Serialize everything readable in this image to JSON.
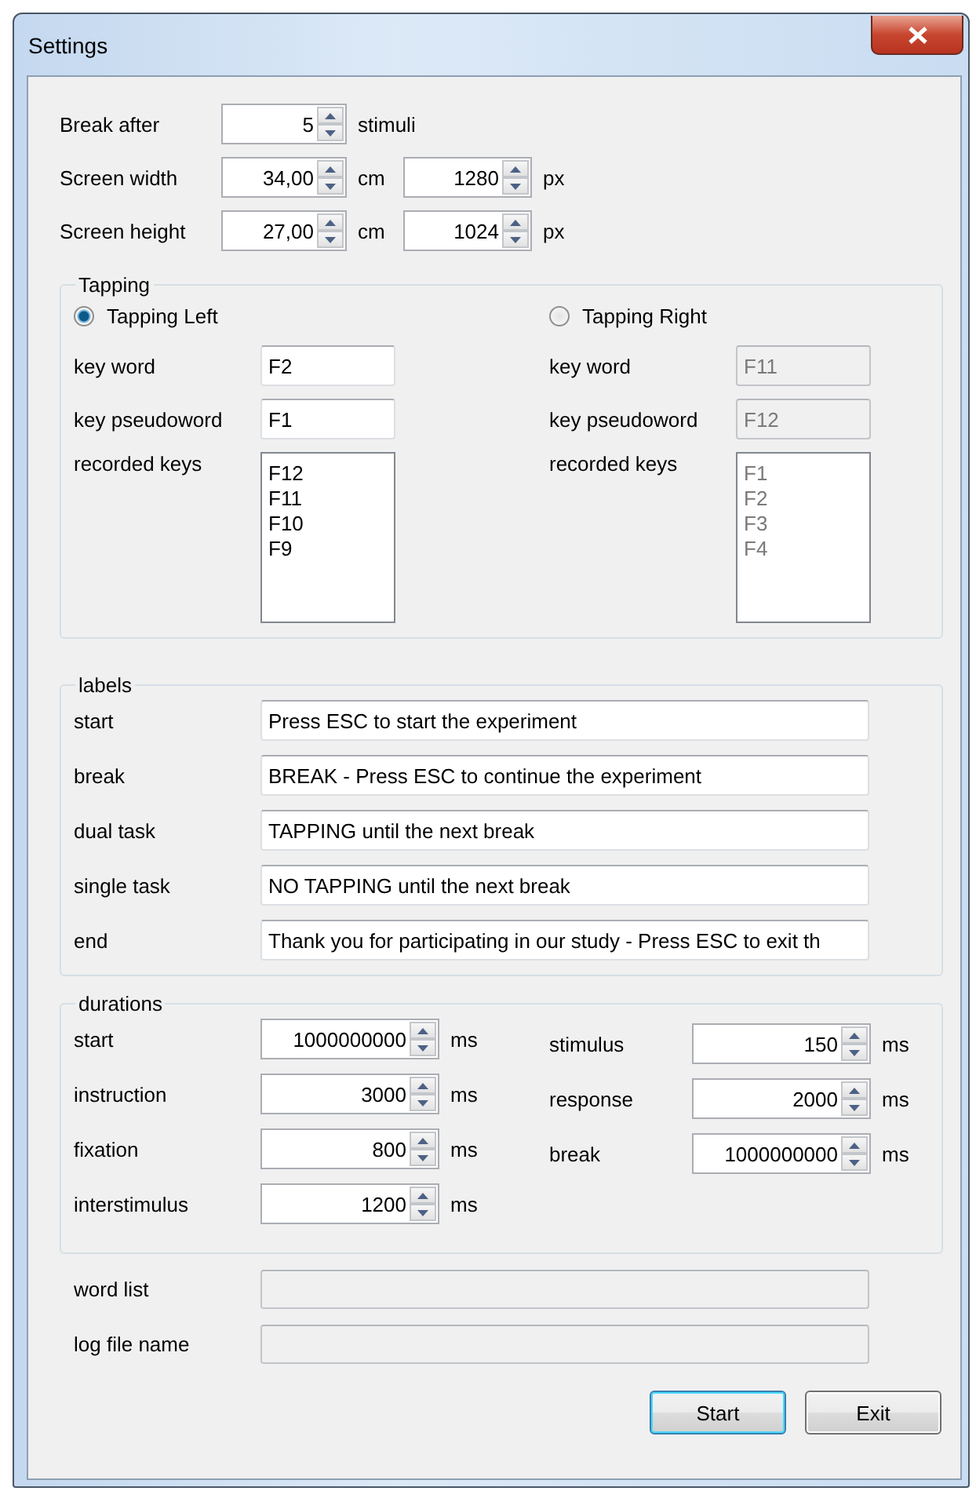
{
  "window": {
    "title": "Settings"
  },
  "screen": [
    {
      "label": "Break after",
      "inputs": [
        {
          "value": "5",
          "unit": "stimuli"
        }
      ]
    },
    {
      "label": "Screen width",
      "inputs": [
        {
          "value": "34,00",
          "unit": "cm"
        },
        {
          "value": "1280",
          "unit": "px"
        }
      ]
    },
    {
      "label": "Screen height",
      "inputs": [
        {
          "value": "27,00",
          "unit": "cm"
        },
        {
          "value": "1024",
          "unit": "px"
        }
      ]
    }
  ],
  "tapping": {
    "title": "Tapping",
    "sides": [
      {
        "label": "Tapping Left",
        "selected": true,
        "disabled": false,
        "fields": [
          {
            "label": "key word",
            "value": "F2"
          },
          {
            "label": "key pseudoword",
            "value": "F1"
          }
        ],
        "recorded_label": "recorded keys",
        "recorded_keys": [
          "F12",
          "F11",
          "F10",
          "F9"
        ]
      },
      {
        "label": "Tapping Right",
        "selected": false,
        "disabled": true,
        "fields": [
          {
            "label": "key word",
            "value": "F11"
          },
          {
            "label": "key pseudoword",
            "value": "F12"
          }
        ],
        "recorded_label": "recorded keys",
        "recorded_keys": [
          "F1",
          "F2",
          "F3",
          "F4"
        ]
      }
    ]
  },
  "labels": {
    "title": "labels",
    "rows": [
      {
        "label": "start",
        "value": "Press ESC to start the experiment"
      },
      {
        "label": "break",
        "value": "BREAK - Press ESC to continue the experiment"
      },
      {
        "label": "dual task",
        "value": "TAPPING until the next break"
      },
      {
        "label": "single task",
        "value": "NO TAPPING until the next break"
      },
      {
        "label": "end",
        "value": "Thank you for participating in our study - Press ESC to exit th"
      }
    ]
  },
  "durations": {
    "title": "durations",
    "columns": [
      [
        {
          "label": "start",
          "value": "1000000000",
          "unit": "ms"
        },
        {
          "label": "instruction",
          "value": "3000",
          "unit": "ms"
        },
        {
          "label": "fixation",
          "value": "800",
          "unit": "ms"
        },
        {
          "label": "interstimulus",
          "value": "1200",
          "unit": "ms"
        }
      ],
      [
        {
          "label": "stimulus",
          "value": "150",
          "unit": "ms"
        },
        {
          "label": "response",
          "value": "2000",
          "unit": "ms"
        },
        {
          "label": "break",
          "value": "1000000000",
          "unit": "ms"
        }
      ]
    ]
  },
  "files": [
    {
      "label": "word list",
      "disabled": true
    },
    {
      "label": "log file name",
      "disabled": true
    }
  ],
  "buttons": [
    {
      "label": "Start",
      "focused": true
    },
    {
      "label": "Exit",
      "focused": false
    }
  ]
}
